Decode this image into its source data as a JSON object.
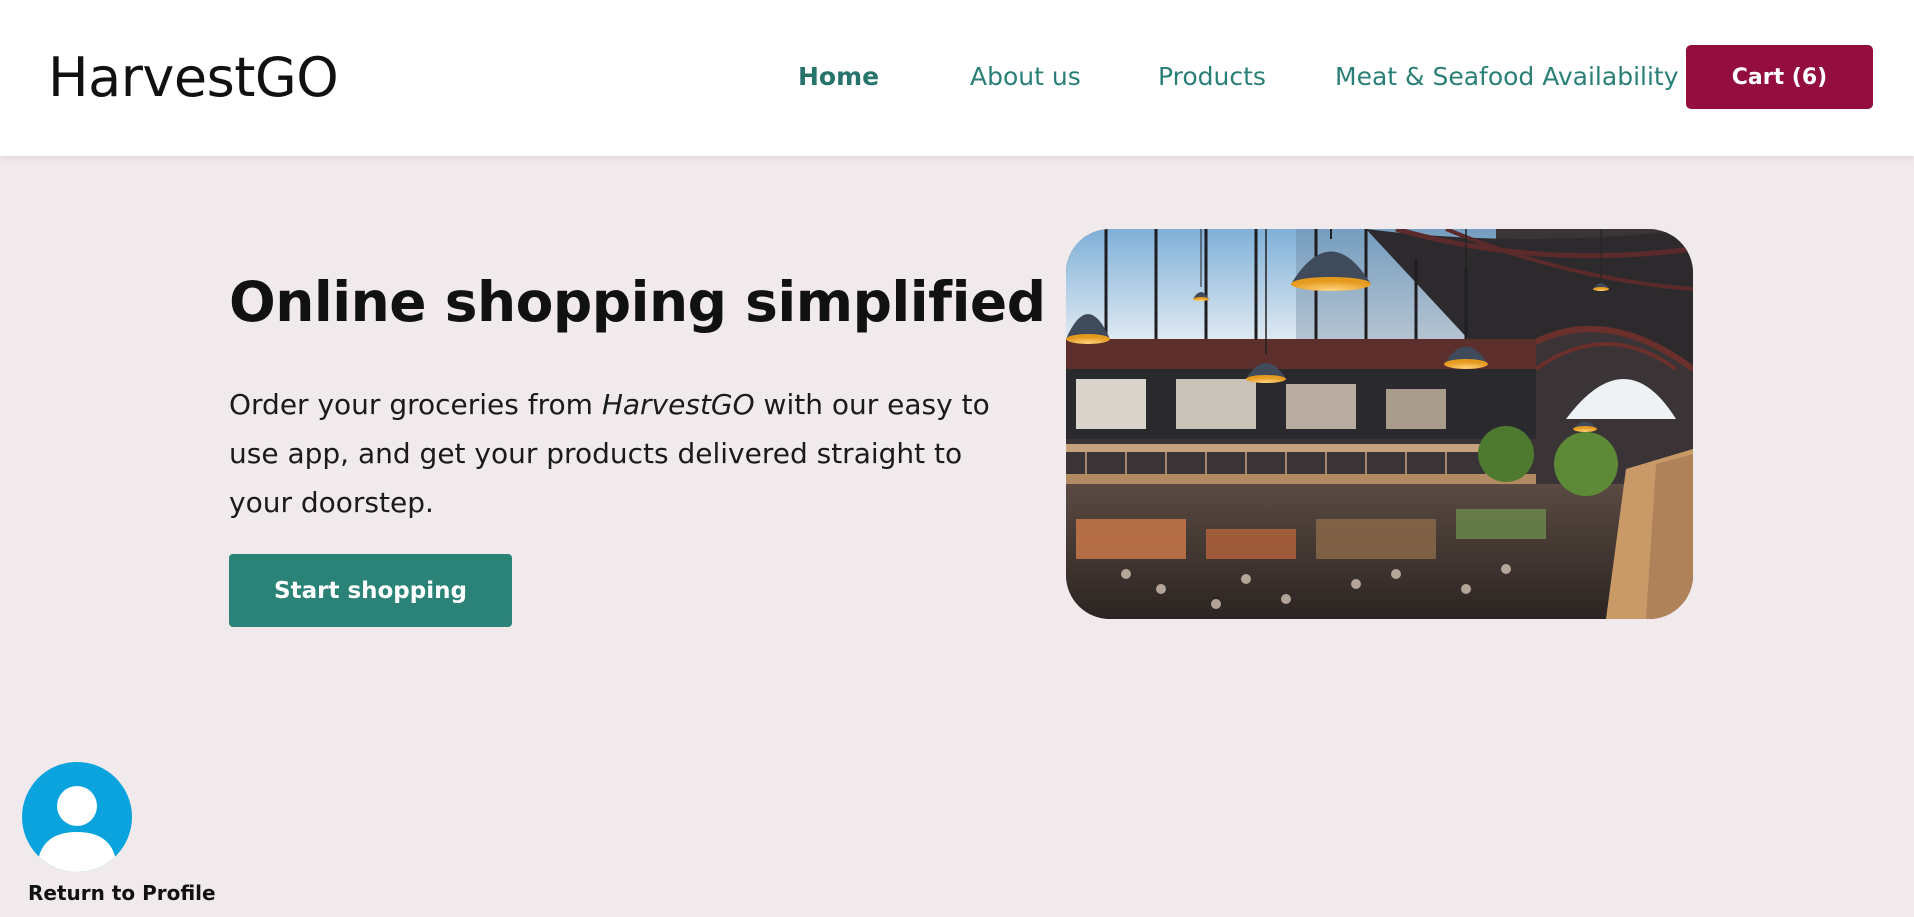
{
  "brand": "HarvestGO",
  "nav": {
    "home": "Home",
    "about": "About us",
    "products": "Products",
    "availability": "Meat & Seafood Availability",
    "cart": "Cart (6)"
  },
  "hero": {
    "title": "Online shopping simplified",
    "text_before": "Order your groceries from ",
    "text_brand": "HarvestGO",
    "text_after": " with our easy to use app, and get your products delivered straight to your doorstep.",
    "button": "Start shopping",
    "image": "market-hall-photo"
  },
  "profile": {
    "label": "Return to Profile",
    "icon": "user-avatar-icon"
  },
  "colors": {
    "accent": "#2b8378",
    "cart": "#930e3e",
    "background": "#f0eaec",
    "profile": "#0aa3dd"
  }
}
